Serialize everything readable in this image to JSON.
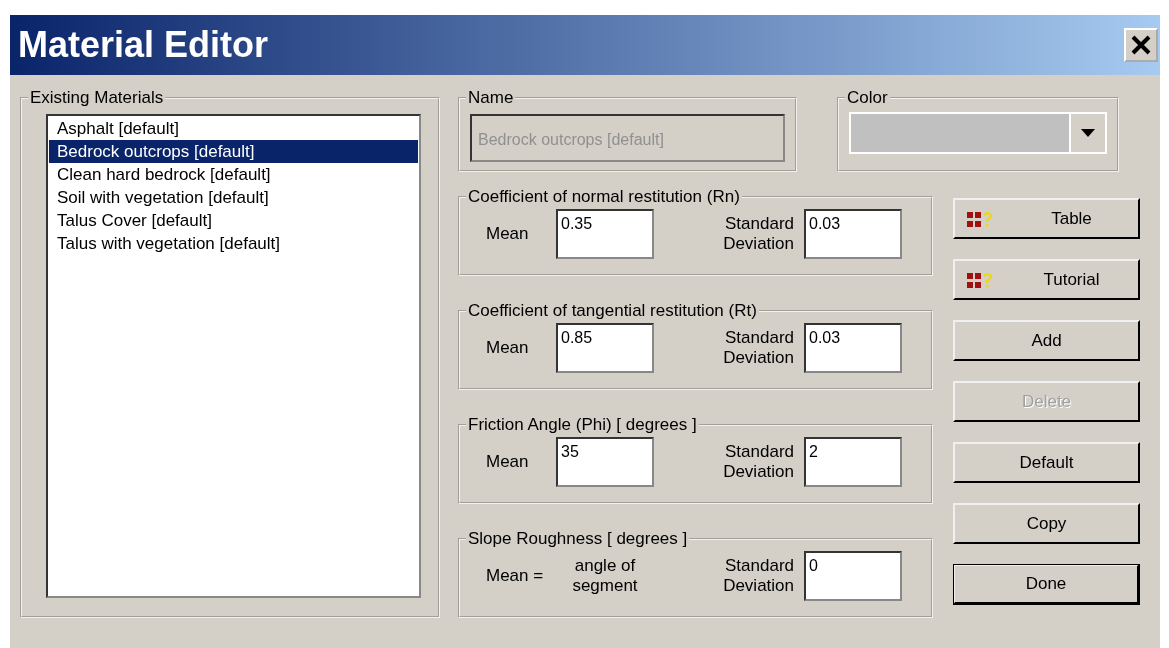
{
  "window": {
    "title": "Material Editor"
  },
  "existing_materials": {
    "label": "Existing Materials",
    "items": [
      {
        "label": "Asphalt [default]",
        "selected": false
      },
      {
        "label": "Bedrock outcrops [default]",
        "selected": true
      },
      {
        "label": "Clean hard bedrock [default]",
        "selected": false
      },
      {
        "label": "Soil with vegetation [default]",
        "selected": false
      },
      {
        "label": "Talus Cover [default]",
        "selected": false
      },
      {
        "label": "Talus with vegetation [default]",
        "selected": false
      }
    ]
  },
  "name": {
    "label": "Name",
    "value": "Bedrock outcrops [default]",
    "disabled": true
  },
  "color": {
    "label": "Color"
  },
  "groups": [
    {
      "title": "Coefficient of normal restitution (Rn)",
      "kind": "input",
      "mean_label": "Mean",
      "mean": "0.35",
      "sd_label": "Standard Deviation",
      "sd": "0.03"
    },
    {
      "title": "Coefficient of tangential restitution (Rt)",
      "kind": "input",
      "mean_label": "Mean",
      "mean": "0.85",
      "sd_label": "Standard Deviation",
      "sd": "0.03"
    },
    {
      "title": "Friction Angle (Phi) [ degrees ]",
      "kind": "input",
      "mean_label": "Mean",
      "mean": "35",
      "sd_label": "Standard Deviation",
      "sd": "2"
    },
    {
      "title": "Slope Roughness [ degrees ]",
      "kind": "fixed",
      "mean_label": "Mean =",
      "mean": "angle of segment",
      "sd_label": "Standard Deviation",
      "sd": "0"
    }
  ],
  "buttons": [
    {
      "label": "Table",
      "kind": "help",
      "disabled": false,
      "default": false
    },
    {
      "label": "Tutorial",
      "kind": "help",
      "disabled": false,
      "default": false
    },
    {
      "label": "Add",
      "kind": "plain",
      "disabled": false,
      "default": false
    },
    {
      "label": "Delete",
      "kind": "plain",
      "disabled": true,
      "default": false
    },
    {
      "label": "Default",
      "kind": "plain",
      "disabled": false,
      "default": false
    },
    {
      "label": "Copy",
      "kind": "plain",
      "disabled": false,
      "default": false
    },
    {
      "label": "Done",
      "kind": "plain",
      "disabled": false,
      "default": true
    }
  ]
}
